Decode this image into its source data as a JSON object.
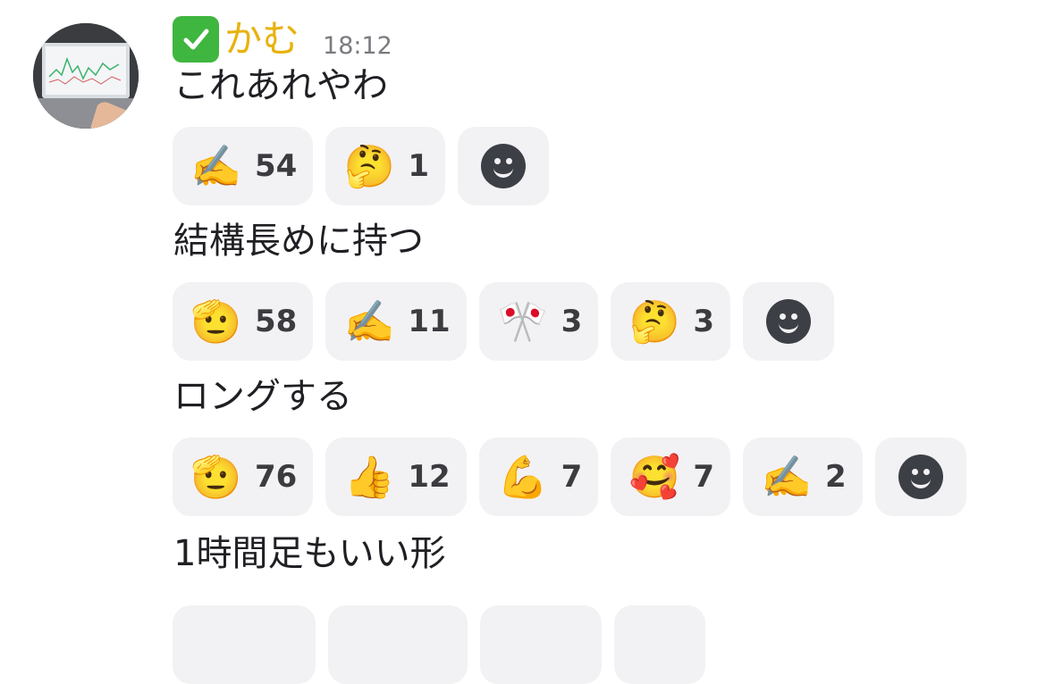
{
  "author": {
    "badge_icon": "check-mark-button-icon",
    "name": "かむ",
    "time": "18:12",
    "name_color": "#e8b20d"
  },
  "messages": [
    {
      "text": "これあれやわ",
      "reactions": [
        {
          "emoji": "✍️",
          "icon": "writing-hand-icon",
          "count": "54"
        },
        {
          "emoji": "🤔",
          "icon": "thinking-face-icon",
          "count": "1"
        }
      ]
    },
    {
      "text": "結構長めに持つ",
      "reactions": [
        {
          "emoji": "🫡",
          "icon": "saluting-face-icon",
          "count": "58"
        },
        {
          "emoji": "✍️",
          "icon": "writing-hand-icon",
          "count": "11"
        },
        {
          "emoji": "🎌",
          "icon": "crossed-flags-icon",
          "count": "3"
        },
        {
          "emoji": "🤔",
          "icon": "thinking-face-icon",
          "count": "3"
        }
      ]
    },
    {
      "text": "ロングする",
      "reactions": [
        {
          "emoji": "🫡",
          "icon": "saluting-face-icon",
          "count": "76"
        },
        {
          "emoji": "👍",
          "icon": "thumbs-up-icon",
          "count": "12"
        },
        {
          "emoji": "💪",
          "icon": "flexed-biceps-icon",
          "count": "7"
        },
        {
          "emoji": "🥰",
          "icon": "smiling-face-with-hearts-icon",
          "count": "7"
        },
        {
          "emoji": "✍️",
          "icon": "writing-hand-icon",
          "count": "2"
        }
      ]
    },
    {
      "text": "1時間足もいい形",
      "reactions": []
    }
  ],
  "add_reaction_icon": "add-reaction-smiley-icon"
}
